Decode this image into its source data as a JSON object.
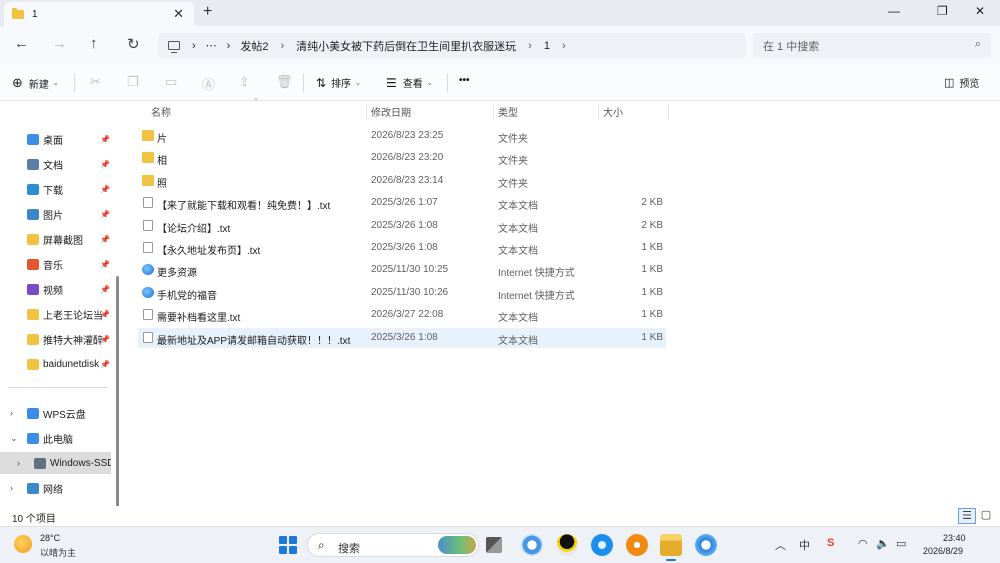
{
  "window": {
    "tab_title": "1",
    "tab_close": "✕",
    "new_tab": "+",
    "minimize": "—",
    "maximize": "❐",
    "close": "✕"
  },
  "nav": {
    "back": "←",
    "forward": "→",
    "up": "↑",
    "refresh": "↻"
  },
  "address": {
    "more": "⋯",
    "crumbs": [
      "发帖2",
      "清纯小美女被下药后倒在卫生间里扒衣服迷玩",
      "1"
    ],
    "separator": "›",
    "chevron_right": "›"
  },
  "search": {
    "placeholder": "在 1 中搜索",
    "icon": "⌕"
  },
  "toolbar": {
    "new_label": "新建",
    "sort_label": "排序",
    "view_label": "查看",
    "more": "•••",
    "preview_label": "预览",
    "icons": {
      "cut": "✂",
      "copy": "❐",
      "paste": "▭",
      "rename": "Ⓐ",
      "share": "⇪",
      "delete": "🗑"
    }
  },
  "sidebar": {
    "pinned": [
      {
        "label": "桌面",
        "icon": "desktop-icon",
        "color": "#3a8ee6"
      },
      {
        "label": "文档",
        "icon": "documents-icon",
        "color": "#5b7fa6"
      },
      {
        "label": "下载",
        "icon": "download-icon",
        "color": "#2b8fd6"
      },
      {
        "label": "图片",
        "icon": "pictures-icon",
        "color": "#3a87c9"
      },
      {
        "label": "屏幕截图",
        "icon": "folder-icon",
        "color": "#f2c341"
      },
      {
        "label": "音乐",
        "icon": "music-icon",
        "color": "#e2572c"
      },
      {
        "label": "视频",
        "icon": "videos-icon",
        "color": "#7a4bc9"
      },
      {
        "label": "上老王论坛当",
        "icon": "folder-icon",
        "color": "#f2c341"
      },
      {
        "label": "推特大神灌醉",
        "icon": "folder-icon",
        "color": "#f2c341"
      },
      {
        "label": "baidunetdisk",
        "icon": "folder-icon",
        "color": "#f2c341"
      }
    ],
    "pin_glyph": "📌",
    "tree": [
      {
        "label": "WPS云盘",
        "chev": "›",
        "icon": "cloud-icon",
        "color": "#3d8be8"
      },
      {
        "label": "此电脑",
        "chev": "⌄",
        "icon": "computer-icon",
        "color": "#3a8ee6"
      },
      {
        "label": "Windows-SSD",
        "chev": "›",
        "icon": "drive-icon",
        "color": "#607080"
      },
      {
        "label": "网络",
        "chev": "›",
        "icon": "network-icon",
        "color": "#3a87c9"
      }
    ]
  },
  "columns": {
    "name": "名称",
    "date": "修改日期",
    "type": "类型",
    "size": "大小",
    "sort_arrow": "⌃"
  },
  "files": [
    {
      "name": "片",
      "date": "2026/8/23 23:25",
      "type": "文件夹",
      "size": "",
      "kind": "folder"
    },
    {
      "name": "相",
      "date": "2026/8/23 23:20",
      "type": "文件夹",
      "size": "",
      "kind": "folder"
    },
    {
      "name": "照",
      "date": "2026/8/23 23:14",
      "type": "文件夹",
      "size": "",
      "kind": "folder"
    },
    {
      "name": "【来了就能下载和观看！纯免费！】.txt",
      "date": "2025/3/26 1:07",
      "type": "文本文档",
      "size": "2 KB",
      "kind": "txt"
    },
    {
      "name": "【论坛介绍】.txt",
      "date": "2025/3/26 1:08",
      "type": "文本文档",
      "size": "2 KB",
      "kind": "txt"
    },
    {
      "name": "【永久地址发布页】.txt",
      "date": "2025/3/26 1:08",
      "type": "文本文档",
      "size": "1 KB",
      "kind": "txt"
    },
    {
      "name": "更多资源",
      "date": "2025/11/30 10:25",
      "type": "Internet 快捷方式",
      "size": "1 KB",
      "kind": "url"
    },
    {
      "name": "手机党的福音",
      "date": "2025/11/30 10:26",
      "type": "Internet 快捷方式",
      "size": "1 KB",
      "kind": "url"
    },
    {
      "name": "需要补档看这里.txt",
      "date": "2026/3/27 22:08",
      "type": "文本文档",
      "size": "1 KB",
      "kind": "txt"
    },
    {
      "name": "最新地址及APP请发邮箱自动获取！！！.txt",
      "date": "2025/3/26 1:08",
      "type": "文本文档",
      "size": "1 KB",
      "kind": "txt"
    }
  ],
  "status": {
    "count": "10 个项目",
    "details_view": "☰",
    "tiles_view": "▢"
  },
  "taskbar": {
    "temp": "28°C",
    "weather": "以晴为主",
    "search_label": "搜索",
    "search_icon": "⌕",
    "tray_up": "︿",
    "ime": "中",
    "wifi": "◠",
    "volume": "🔈",
    "battery": "▭",
    "time": "23:40",
    "date": "2026/8/29"
  }
}
